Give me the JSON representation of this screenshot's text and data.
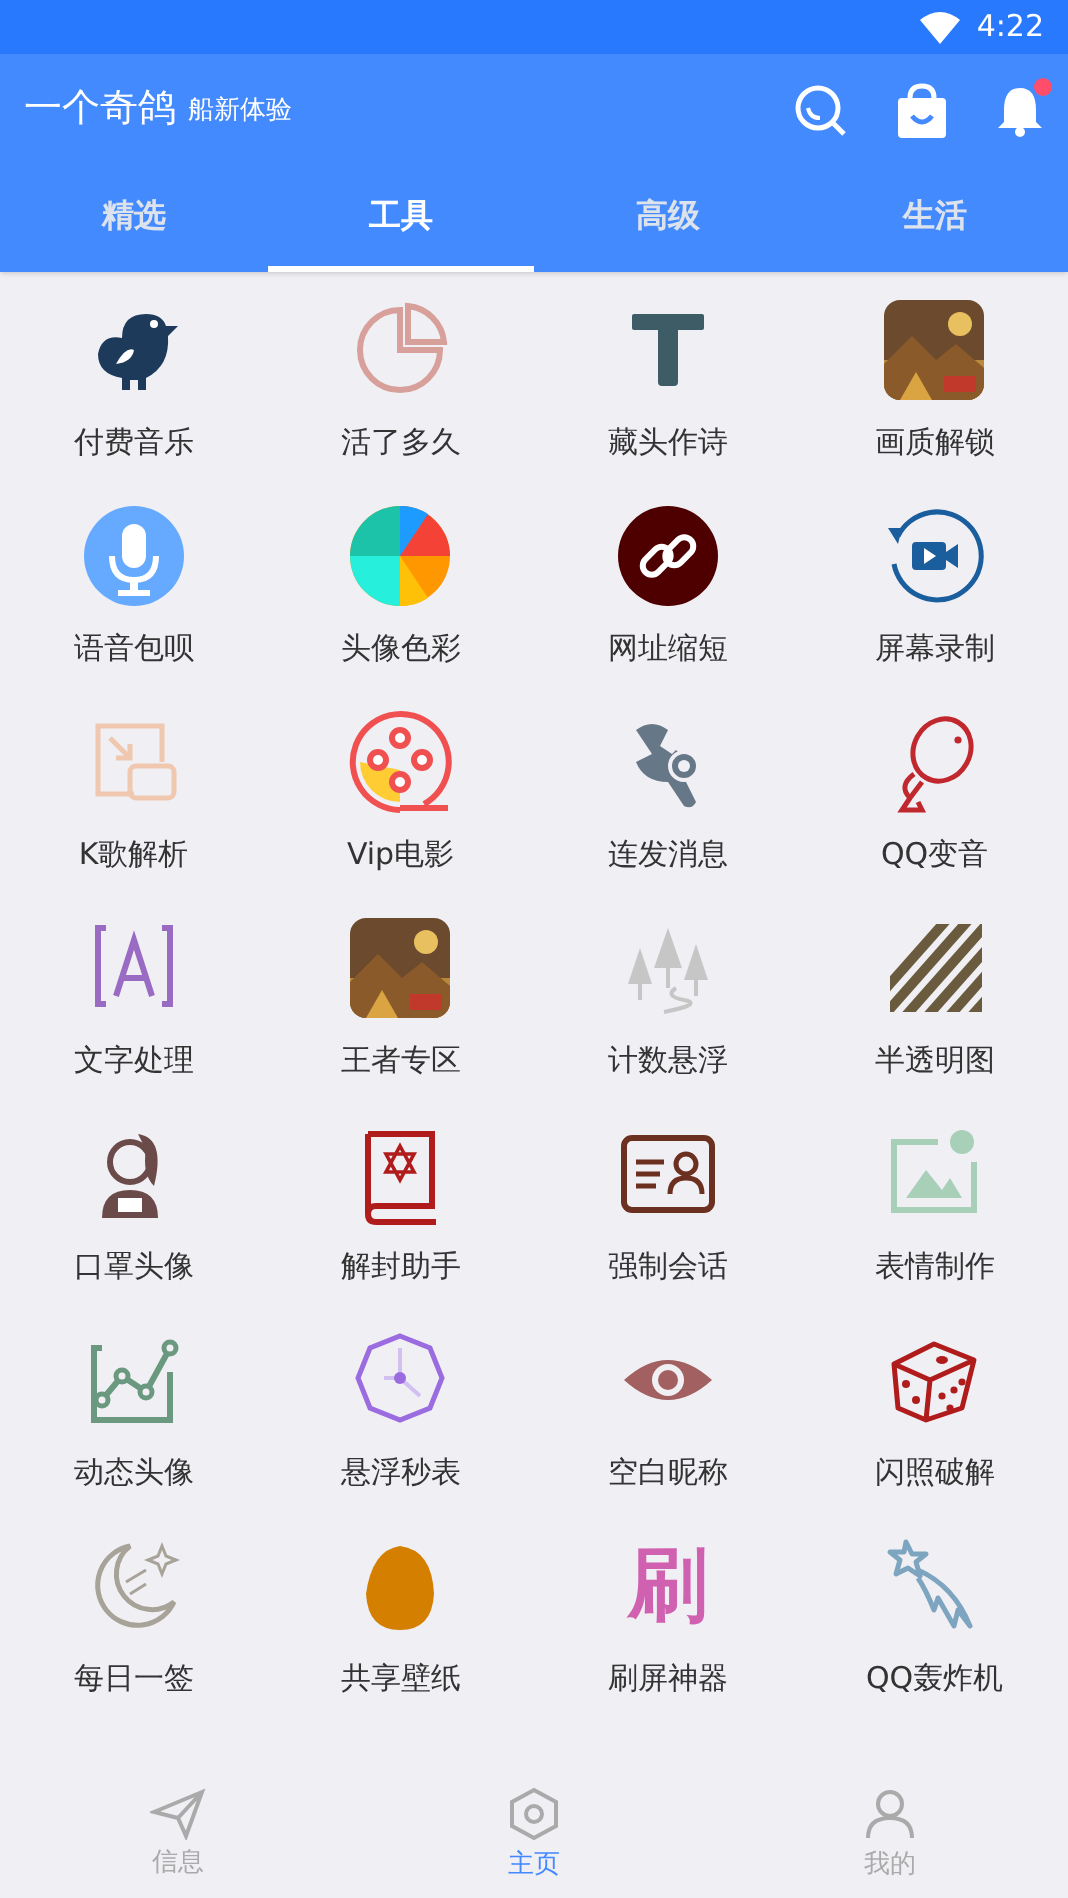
{
  "status_bar": {
    "time": "4:22"
  },
  "app_bar": {
    "title": "一个奇鸽",
    "subtitle": "船新体验",
    "notification_dot": true
  },
  "tabs": [
    {
      "label": "精选",
      "selected": false
    },
    {
      "label": "工具",
      "selected": true
    },
    {
      "label": "高级",
      "selected": false
    },
    {
      "label": "生活",
      "selected": false
    }
  ],
  "tool_rows": [
    [
      {
        "label": "付费音乐"
      },
      {
        "label": "活了多久"
      },
      {
        "label": "藏头作诗"
      },
      {
        "label": "画质解锁"
      }
    ],
    [
      {
        "label": "语音包呗"
      },
      {
        "label": "头像色彩"
      },
      {
        "label": "网址缩短"
      },
      {
        "label": "屏幕录制"
      }
    ],
    [
      {
        "label": "K歌解析"
      },
      {
        "label": "Vip电影"
      },
      {
        "label": "连发消息"
      },
      {
        "label": "QQ变音"
      }
    ],
    [
      {
        "label": "文字处理"
      },
      {
        "label": "王者专区"
      },
      {
        "label": "计数悬浮"
      },
      {
        "label": "半透明图"
      }
    ],
    [
      {
        "label": "口罩头像"
      },
      {
        "label": "解封助手"
      },
      {
        "label": "强制会话"
      },
      {
        "label": "表情制作"
      }
    ],
    [
      {
        "label": "动态头像"
      },
      {
        "label": "悬浮秒表"
      },
      {
        "label": "空白昵称"
      },
      {
        "label": "闪照破解"
      }
    ],
    [
      {
        "label": "每日一签"
      },
      {
        "label": "共享壁纸"
      },
      {
        "icon_text": "刷",
        "label": "刷屏神器"
      },
      {
        "label": "QQ轰炸机"
      }
    ]
  ],
  "bottom_nav": [
    {
      "label": "信息",
      "selected": false
    },
    {
      "label": "主页",
      "selected": true
    },
    {
      "label": "我的",
      "selected": false
    }
  ]
}
